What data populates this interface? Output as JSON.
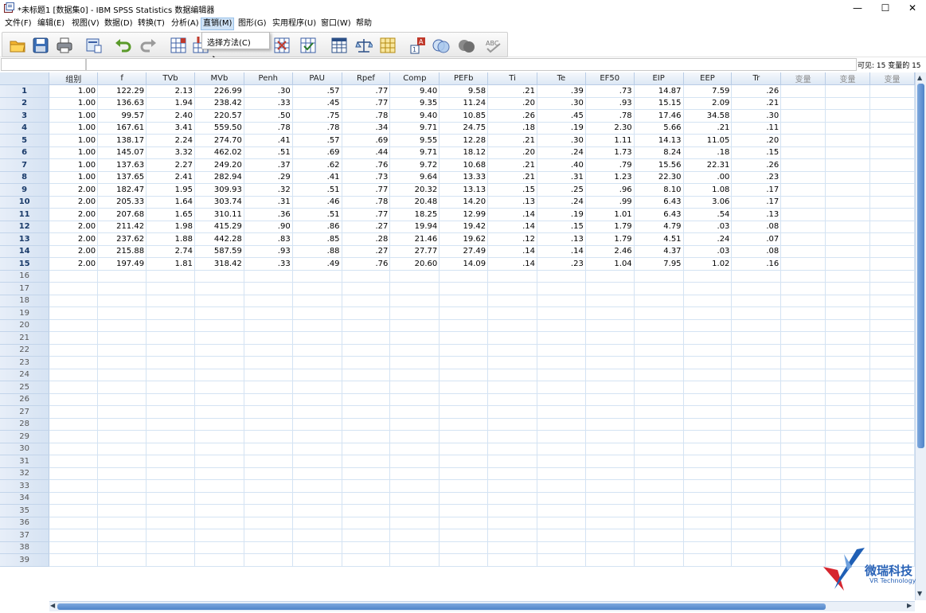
{
  "window": {
    "title": "*未标题1 [数据集0] - IBM SPSS Statistics 数据编辑器",
    "minimize": "—",
    "maximize": "☐",
    "close": "✕"
  },
  "menu": {
    "items": [
      "文件(F)",
      "编辑(E)",
      "视图(V)",
      "数据(D)",
      "转换(T)",
      "分析(A)",
      "直销(M)",
      "图形(G)",
      "实用程序(U)",
      "窗口(W)",
      "帮助"
    ],
    "active_index": 6
  },
  "dropdown": {
    "items": [
      "选择方法(C)"
    ]
  },
  "toolbar": {
    "icons": [
      "open-folder-icon",
      "save-icon",
      "print-icon",
      "dialog-recall-icon",
      "undo-icon",
      "redo-icon",
      "goto-case-icon",
      "goto-variable-icon",
      "variables-icon",
      "find-icon",
      "insert-cases-icon",
      "insert-variable-icon",
      "split-file-icon",
      "weight-cases-icon",
      "select-cases-icon",
      "value-labels-icon",
      "use-sets-icon",
      "show-all-variables-icon",
      "spell-check-icon"
    ]
  },
  "status": {
    "visible_vars": "可见: 15 变量的 15"
  },
  "grid": {
    "columns": [
      "组别",
      "f",
      "TVb",
      "MVb",
      "Penh",
      "PAU",
      "Rpef",
      "Comp",
      "PEFb",
      "Ti",
      "Te",
      "EF50",
      "EIP",
      "EEP",
      "Tr",
      "变量",
      "变量",
      "变量"
    ],
    "rows": [
      [
        "1.00",
        "122.29",
        "2.13",
        "226.99",
        ".30",
        ".57",
        ".77",
        "9.40",
        "9.58",
        ".21",
        ".39",
        ".73",
        "14.87",
        "7.59",
        ".26"
      ],
      [
        "1.00",
        "136.63",
        "1.94",
        "238.42",
        ".33",
        ".45",
        ".77",
        "9.35",
        "11.24",
        ".20",
        ".30",
        ".93",
        "15.15",
        "2.09",
        ".21"
      ],
      [
        "1.00",
        "99.57",
        "2.40",
        "220.57",
        ".50",
        ".75",
        ".78",
        "9.40",
        "10.85",
        ".26",
        ".45",
        ".78",
        "17.46",
        "34.58",
        ".30"
      ],
      [
        "1.00",
        "167.61",
        "3.41",
        "559.50",
        ".78",
        ".78",
        ".34",
        "9.71",
        "24.75",
        ".18",
        ".19",
        "2.30",
        "5.66",
        ".21",
        ".11"
      ],
      [
        "1.00",
        "138.17",
        "2.24",
        "274.70",
        ".41",
        ".57",
        ".69",
        "9.55",
        "12.28",
        ".21",
        ".30",
        "1.11",
        "14.13",
        "11.05",
        ".20"
      ],
      [
        "1.00",
        "145.07",
        "3.32",
        "462.02",
        ".51",
        ".69",
        ".44",
        "9.71",
        "18.12",
        ".20",
        ".24",
        "1.73",
        "8.24",
        ".18",
        ".15"
      ],
      [
        "1.00",
        "137.63",
        "2.27",
        "249.20",
        ".37",
        ".62",
        ".76",
        "9.72",
        "10.68",
        ".21",
        ".40",
        ".79",
        "15.56",
        "22.31",
        ".26"
      ],
      [
        "1.00",
        "137.65",
        "2.41",
        "282.94",
        ".29",
        ".41",
        ".73",
        "9.64",
        "13.33",
        ".21",
        ".31",
        "1.23",
        "22.30",
        ".00",
        ".23"
      ],
      [
        "2.00",
        "182.47",
        "1.95",
        "309.93",
        ".32",
        ".51",
        ".77",
        "20.32",
        "13.13",
        ".15",
        ".25",
        ".96",
        "8.10",
        "1.08",
        ".17"
      ],
      [
        "2.00",
        "205.33",
        "1.64",
        "303.74",
        ".31",
        ".46",
        ".78",
        "20.48",
        "14.20",
        ".13",
        ".24",
        ".99",
        "6.43",
        "3.06",
        ".17"
      ],
      [
        "2.00",
        "207.68",
        "1.65",
        "310.11",
        ".36",
        ".51",
        ".77",
        "18.25",
        "12.99",
        ".14",
        ".19",
        "1.01",
        "6.43",
        ".54",
        ".13"
      ],
      [
        "2.00",
        "211.42",
        "1.98",
        "415.29",
        ".90",
        ".86",
        ".27",
        "19.94",
        "19.42",
        ".14",
        ".15",
        "1.79",
        "4.79",
        ".03",
        ".08"
      ],
      [
        "2.00",
        "237.62",
        "1.88",
        "442.28",
        ".83",
        ".85",
        ".28",
        "21.46",
        "19.62",
        ".12",
        ".13",
        "1.79",
        "4.51",
        ".24",
        ".07"
      ],
      [
        "2.00",
        "215.88",
        "2.74",
        "587.59",
        ".93",
        ".88",
        ".27",
        "27.77",
        "27.49",
        ".14",
        ".14",
        "2.46",
        "4.37",
        ".03",
        ".08"
      ],
      [
        "2.00",
        "197.49",
        "1.81",
        "318.42",
        ".33",
        ".49",
        ".76",
        "20.60",
        "14.09",
        ".14",
        ".23",
        "1.04",
        "7.95",
        "1.02",
        ".16"
      ]
    ],
    "total_rows": 39
  },
  "watermark": {
    "name": "微瑞科技",
    "subtitle": "VR Technology"
  }
}
